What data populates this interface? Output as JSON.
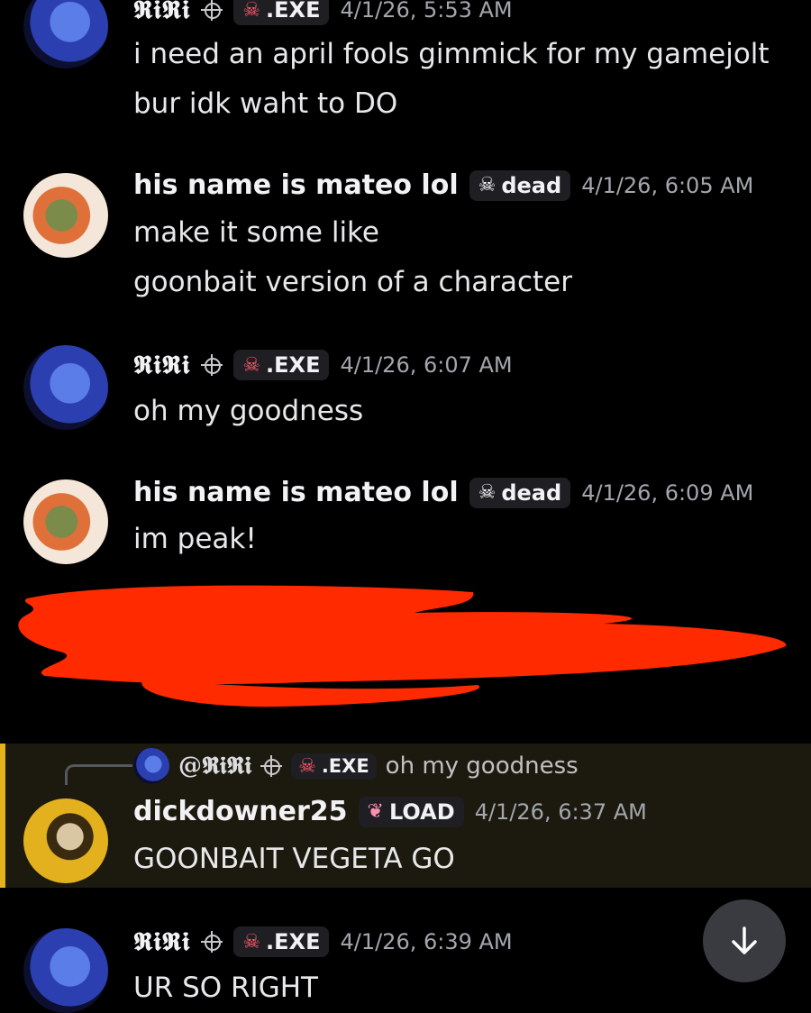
{
  "messages": [
    {
      "author": "𝕽𝖎𝕽𝖎",
      "tag": ".EXE",
      "time": "4/1/26, 5:53 AM",
      "lines": [
        "i need an april fools gimmick for my gamejolt",
        "bur idk waht to DO"
      ]
    },
    {
      "author": "his name is mateo lol",
      "tag": "dead",
      "time": "4/1/26, 6:05 AM",
      "lines": [
        "make it some like",
        "goonbait version of a character"
      ]
    },
    {
      "author": "𝕽𝖎𝕽𝖎",
      "tag": ".EXE",
      "time": "4/1/26, 6:07 AM",
      "lines": [
        "oh my goodness"
      ]
    },
    {
      "author": "his name is mateo lol",
      "tag": "dead",
      "time": "4/1/26, 6:09 AM",
      "lines": [
        "im peak!"
      ]
    },
    {
      "author": "dickdowner25",
      "tag": "LOAD",
      "time": "4/1/26, 6:37 AM",
      "lines": [
        "GOONBAIT VEGETA GO"
      ],
      "reply": {
        "author": "@𝕽𝖎𝕽𝖎",
        "tag": ".EXE",
        "text": "oh my goodness"
      }
    },
    {
      "author": "𝕽𝖎𝕽𝖎",
      "tag": ".EXE",
      "time": "4/1/26, 6:39 AM",
      "lines": [
        "UR SO RIGHT"
      ]
    }
  ],
  "icons": {
    "skull": "skull-icon",
    "crosshair": "crosshair-icon",
    "flame": "flame-icon",
    "scroll": "arrow-down-icon"
  },
  "colors": {
    "background": "#000000",
    "redaction": "#ff2a00",
    "reply_highlight": "#e6b21c"
  }
}
